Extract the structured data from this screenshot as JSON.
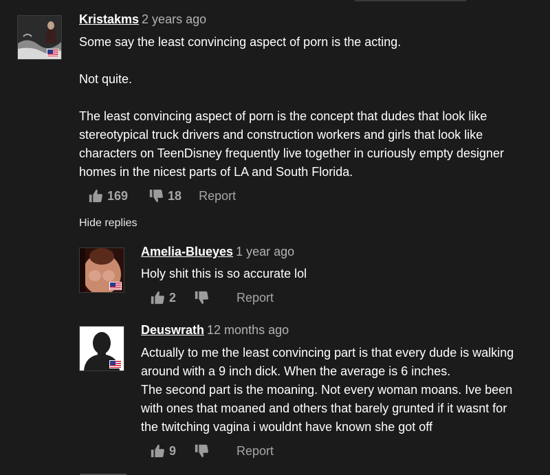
{
  "comments": [
    {
      "username": "Kristakms",
      "time": "2 years ago",
      "body": [
        "Some say the least convincing aspect of porn is the acting.",
        "",
        "Not quite.",
        "",
        "The least convincing aspect of porn is the concept that dudes that look like",
        "stereotypical truck drivers and construction workers and girls that look like",
        "characters on TeenDisney frequently live together in curiously empty designer",
        "homes in the nicest parts of LA and South Florida."
      ],
      "upvotes": "169",
      "downvotes": "18",
      "report_label": "Report",
      "avatar_flag": "us-flag-icon"
    }
  ],
  "hide_replies_label": "Hide replies",
  "replies": [
    {
      "username": "Amelia-Blueyes",
      "time": "1 year ago",
      "body": [
        "Holy shit this is so accurate lol"
      ],
      "upvotes": "2",
      "downvotes": "",
      "report_label": "Report",
      "avatar_flag": "us-flag-icon"
    },
    {
      "username": "Deuswrath",
      "time": "12 months ago",
      "body": [
        "Actually to me the least convincing part is that every dude is walking",
        "around with a 9 inch dick. When the average is 6 inches.",
        "The second part is the moaning. Not every woman moans. Ive been",
        "with ones that moaned and others that barely grunted if it wasnt for",
        "the twitching vagina i wouldnt have known she got off"
      ],
      "upvotes": "9",
      "downvotes": "",
      "report_label": "Report",
      "avatar_flag": "us-flag-icon"
    }
  ],
  "colors": {
    "background": "#1b1b1b",
    "text": "#ffffff",
    "muted": "#a6a6a6",
    "timestamp": "#b3b3b3"
  }
}
